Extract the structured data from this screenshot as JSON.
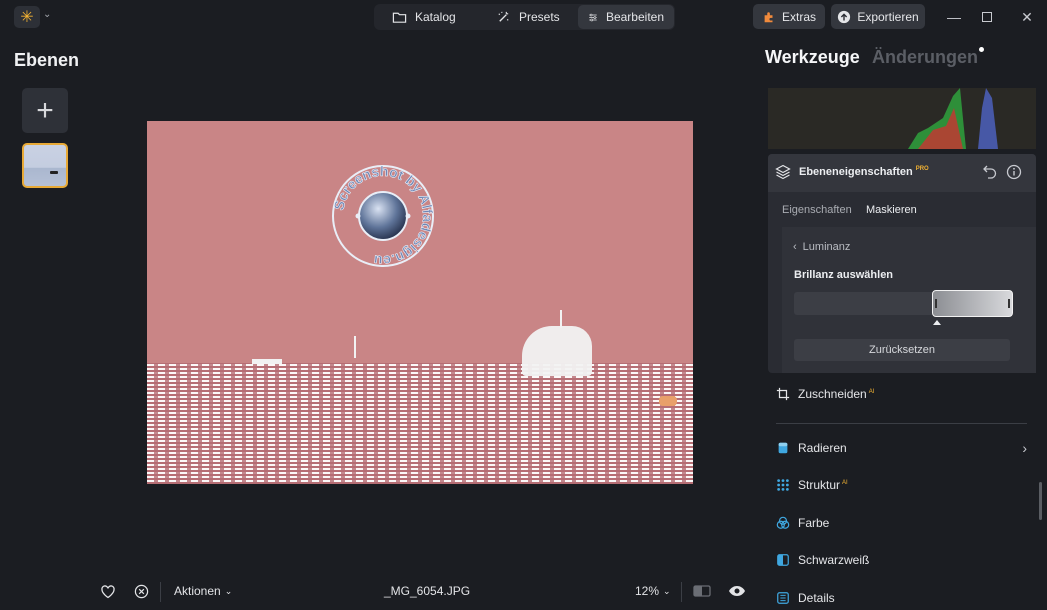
{
  "topbar": {
    "tabs": [
      {
        "label": "Katalog",
        "icon": "folder-icon"
      },
      {
        "label": "Presets",
        "icon": "magic-wand-icon"
      },
      {
        "label": "Bearbeiten",
        "icon": "sliders-icon"
      }
    ],
    "extras_label": "Extras",
    "export_label": "Exportieren",
    "accent_color": "#f2b233"
  },
  "left_panel": {
    "title": "Ebenen"
  },
  "canvas": {
    "watermark_text": "Screenshot by Alfadesign.eu"
  },
  "bottom_bar": {
    "actions_label": "Aktionen",
    "filename": "_MG_6054.JPG",
    "zoom": "12%"
  },
  "right_panel": {
    "tab_tools": "Werkzeuge",
    "tab_changes": "Änderungen",
    "layer_props": {
      "title": "Ebeneneigenschaften",
      "badge": "PRO",
      "subtabs": [
        "Eigenschaften",
        "Maskieren"
      ],
      "back_label": "Luminanz",
      "range_label": "Brillanz auswählen",
      "reset_label": "Zurücksetzen"
    },
    "tools": [
      {
        "label": "Zuschneiden",
        "ai": "AI"
      },
      {
        "label": "Radieren",
        "ai": ""
      },
      {
        "label": "Struktur",
        "ai": "AI"
      },
      {
        "label": "Farbe",
        "ai": ""
      },
      {
        "label": "Schwarzweiß",
        "ai": ""
      },
      {
        "label": "Details",
        "ai": ""
      }
    ]
  }
}
